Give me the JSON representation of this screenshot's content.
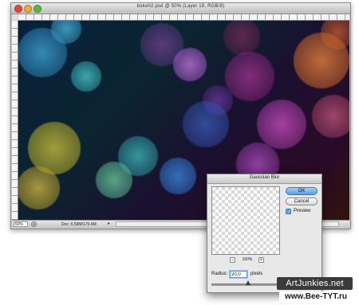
{
  "document_window": {
    "title": "bokeh2.psd @ 50% (Layer 18, RGB/8)",
    "status_bar": {
      "zoom": "50%",
      "doc_info": "Doc: 6.59M/170.4M"
    }
  },
  "gaussian_blur_dialog": {
    "title": "Gaussian Blur",
    "ok_label": "OK",
    "cancel_label": "Cancel",
    "preview_label": "Preview",
    "preview_checked": true,
    "zoom_level": "100%",
    "radius_label": "Radius:",
    "radius_value": "20.0",
    "radius_unit": "pixels",
    "radius_slider_fraction": 0.35
  },
  "watermarks": {
    "primary": "ArtJunkies.net",
    "secondary": "www.Bee-TYT.ru"
  },
  "colors": {
    "ok_accent": "#5a9de0",
    "close_light": "#e2463f",
    "minimize_light": "#e8b030",
    "maximize_light": "#5cb640"
  }
}
